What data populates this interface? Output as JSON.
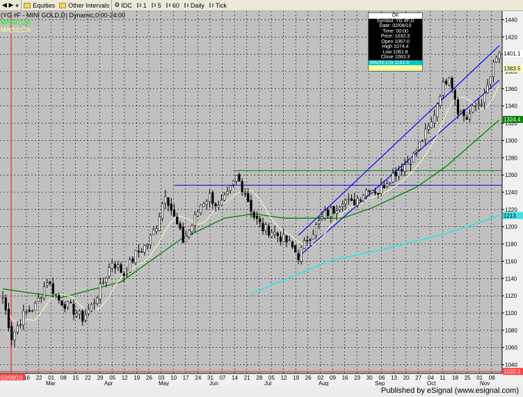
{
  "toolbar": {
    "items": [
      {
        "label": "Equities",
        "icon": "folder-icon"
      },
      {
        "label": "Other Intervals",
        "icon": "folder-icon"
      },
      {
        "label": "IDC",
        "icon": "gear-icon"
      },
      {
        "label": "1",
        "icon": "bar-icon"
      },
      {
        "label": "5",
        "icon": "bar-icon"
      },
      {
        "label": "60",
        "icon": "bar-icon"
      },
      {
        "label": "Daily",
        "icon": "bar-icon"
      },
      {
        "label": "Tick",
        "icon": "bar-icon"
      }
    ]
  },
  "footer": {
    "published": "Published by eSignal (www.esignal.com)"
  },
  "databox": {
    "header": "OK",
    "lines": [
      "Symbol: YG #F,D",
      "Date: 02/08/10",
      "Time: 00:00",
      "Price: 1032.3",
      "Open 1067.0",
      "High 1074.4",
      "Low 1061.8",
      "Close 1063.3"
    ],
    "ma50": "MA(50,C)s 1122.5"
  },
  "chart_data": {
    "type": "candlestick",
    "title": "(YG #F - MINI GOLD,D) Dynamic,0:00-24:00",
    "legend": [
      {
        "name": "MA(50,C)e",
        "color": "#00ff00"
      },
      {
        "name": "MA(10,C)e",
        "color": "#ffff99"
      }
    ],
    "colors": {
      "background": "#c0c0c0",
      "candle": "#000000",
      "ma50": "#008000",
      "ma10": "#ffffc0",
      "ma200": "#40e0e0",
      "channel": "#0000ff",
      "horizontal": "#008000",
      "cursor": "#ff0000"
    },
    "x_tick_labels": [
      "16",
      "22",
      "01",
      "08",
      "15",
      "22",
      "29",
      "05",
      "12",
      "19",
      "26",
      "03",
      "10",
      "17",
      "24",
      "31",
      "07",
      "14",
      "21",
      "28",
      "05",
      "12",
      "19",
      "26",
      "02",
      "09",
      "16",
      "23",
      "30",
      "06",
      "13",
      "20",
      "27",
      "04",
      "11",
      "18",
      "25",
      "01",
      "08"
    ],
    "month_labels": [
      "Mar",
      "Apr",
      "May",
      "Jun",
      "Jul",
      "Aug",
      "Sep",
      "Oct",
      "Nov"
    ],
    "cursor_date_label": "02/08/10",
    "ylim": [
      1030,
      1450
    ],
    "y_ticks": [
      1040,
      1060,
      1080,
      1100,
      1120,
      1140,
      1160,
      1180,
      1200,
      1220,
      1240,
      1260,
      1280,
      1300,
      1320,
      1340,
      1360,
      1380,
      1400,
      1420,
      1440
    ],
    "price_tags": [
      {
        "value": 1401.1,
        "bg": "#ffffff",
        "fg": "#000000"
      },
      {
        "value": 1383.5,
        "bg": "#ffffc0",
        "fg": "#000000"
      },
      {
        "value": 1324.4,
        "bg": "#008000",
        "fg": "#ffffff"
      },
      {
        "value": 1213,
        "bg": "#40e0e0",
        "fg": "#000000"
      },
      {
        "value": 1032.3,
        "bg": "#ff4040",
        "fg": "#ffffff"
      }
    ],
    "close_keypoints": [
      [
        0,
        1118
      ],
      [
        3,
        1072
      ],
      [
        7,
        1098
      ],
      [
        11,
        1108
      ],
      [
        15,
        1138
      ],
      [
        19,
        1115
      ],
      [
        23,
        1106
      ],
      [
        27,
        1094
      ],
      [
        30,
        1108
      ],
      [
        33,
        1128
      ],
      [
        37,
        1160
      ],
      [
        41,
        1145
      ],
      [
        45,
        1168
      ],
      [
        49,
        1180
      ],
      [
        52,
        1202
      ],
      [
        55,
        1240
      ],
      [
        58,
        1210
      ],
      [
        61,
        1184
      ],
      [
        64,
        1202
      ],
      [
        67,
        1226
      ],
      [
        70,
        1236
      ],
      [
        73,
        1222
      ],
      [
        76,
        1236
      ],
      [
        79,
        1258
      ],
      [
        82,
        1240
      ],
      [
        85,
        1212
      ],
      [
        88,
        1198
      ],
      [
        91,
        1195
      ],
      [
        94,
        1188
      ],
      [
        97,
        1180
      ],
      [
        100,
        1166
      ],
      [
        103,
        1186
      ],
      [
        106,
        1200
      ],
      [
        109,
        1214
      ],
      [
        112,
        1220
      ],
      [
        115,
        1232
      ],
      [
        118,
        1226
      ],
      [
        121,
        1236
      ],
      [
        124,
        1246
      ],
      [
        127,
        1240
      ],
      [
        130,
        1254
      ],
      [
        133,
        1264
      ],
      [
        136,
        1272
      ],
      [
        139,
        1282
      ],
      [
        142,
        1302
      ],
      [
        145,
        1320
      ],
      [
        148,
        1356
      ],
      [
        151,
        1378
      ],
      [
        154,
        1336
      ],
      [
        157,
        1326
      ],
      [
        160,
        1340
      ],
      [
        163,
        1350
      ],
      [
        166,
        1386
      ],
      [
        168,
        1402
      ]
    ],
    "ma50_keypoints": [
      [
        0,
        1128
      ],
      [
        20,
        1118
      ],
      [
        40,
        1136
      ],
      [
        60,
        1185
      ],
      [
        75,
        1210
      ],
      [
        85,
        1215
      ],
      [
        95,
        1210
      ],
      [
        115,
        1210
      ],
      [
        125,
        1222
      ],
      [
        140,
        1246
      ],
      [
        150,
        1270
      ],
      [
        160,
        1300
      ],
      [
        168,
        1324
      ]
    ],
    "ma200_keypoints": [
      [
        84,
        1122
      ],
      [
        110,
        1160
      ],
      [
        130,
        1175
      ],
      [
        150,
        1192
      ],
      [
        168,
        1213
      ]
    ],
    "channel": {
      "lower": [
        [
          100,
          1165
        ],
        [
          168,
          1370
        ]
      ],
      "upper": [
        [
          100,
          1190
        ],
        [
          168,
          1410
        ]
      ]
    },
    "horizontal_lines": [
      {
        "from": 78,
        "to": 168,
        "value": 1265,
        "color": "#008000"
      },
      {
        "from": 58,
        "to": 168,
        "value": 1248,
        "color": "#0000cc"
      }
    ],
    "bars": 169
  }
}
